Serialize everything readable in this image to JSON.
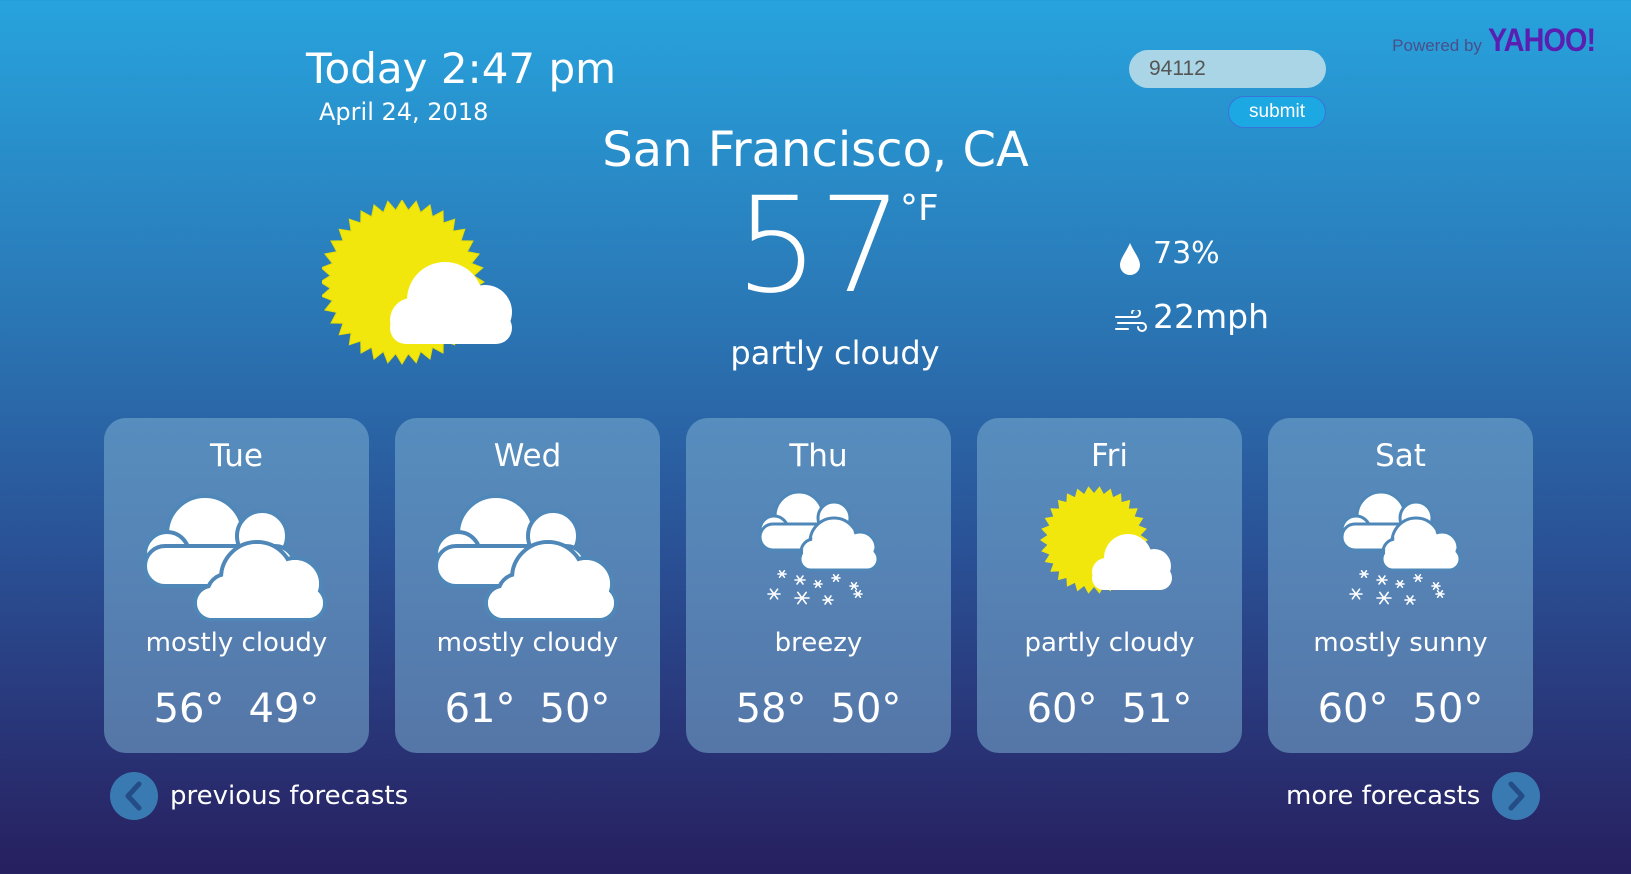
{
  "attribution": {
    "powered_by": "Powered by",
    "brand": "YAHOO!"
  },
  "header": {
    "today": "Today 2:47 pm",
    "date": "April 24, 2018"
  },
  "search": {
    "value": "94112",
    "submit_label": "submit"
  },
  "current": {
    "city": "San Francisco, CA",
    "temperature": "57",
    "unit": "°F",
    "condition": "partly cloudy",
    "humidity": "73%",
    "wind": "22mph",
    "icon": "partly-cloudy-icon"
  },
  "forecast": [
    {
      "day": "Tue",
      "condition": "mostly cloudy",
      "high": "56°",
      "low": "49°",
      "icon": "mostly-cloudy-icon"
    },
    {
      "day": "Wed",
      "condition": "mostly cloudy",
      "high": "61°",
      "low": "50°",
      "icon": "mostly-cloudy-icon"
    },
    {
      "day": "Thu",
      "condition": "breezy",
      "high": "58°",
      "low": "50°",
      "icon": "snow-cloud-icon"
    },
    {
      "day": "Fri",
      "condition": "partly cloudy",
      "high": "60°",
      "low": "51°",
      "icon": "partly-cloudy-icon"
    },
    {
      "day": "Sat",
      "condition": "mostly sunny",
      "high": "60°",
      "low": "50°",
      "icon": "snow-cloud-icon"
    }
  ],
  "nav": {
    "previous_label": "previous forecasts",
    "next_label": "more forecasts"
  },
  "colors": {
    "sun": "#f2e70c",
    "card_bg": "#7aaed2",
    "nav_circle": "#3a7ab2",
    "submit_bg": "#1ba8e3"
  }
}
